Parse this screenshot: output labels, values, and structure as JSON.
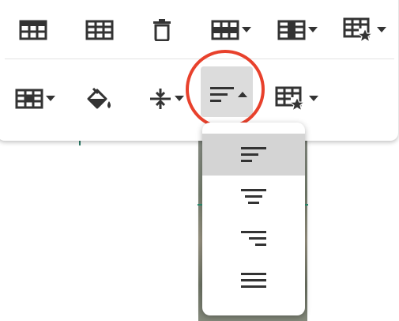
{
  "toolbar": {
    "row1": [
      {
        "icon": "table-icon"
      },
      {
        "icon": "table-grid-icon"
      },
      {
        "icon": "trash-icon"
      },
      {
        "icon": "table-row-icon",
        "dropdown": true
      },
      {
        "icon": "table-column-icon",
        "dropdown": true
      },
      {
        "icon": "table-star-icon",
        "dropdown": true
      }
    ],
    "row2": [
      {
        "icon": "table-cell-icon",
        "dropdown": true
      },
      {
        "icon": "fill-color-icon"
      },
      {
        "icon": "vertical-align-icon",
        "dropdown": true
      },
      {
        "icon": "text-align-left-icon",
        "dropdown": true,
        "active": true
      },
      {
        "icon": "table-star-icon",
        "dropdown": true
      }
    ]
  },
  "align_menu": {
    "options": [
      {
        "icon": "align-left-icon",
        "selected": true
      },
      {
        "icon": "align-center-icon",
        "selected": false
      },
      {
        "icon": "align-right-icon",
        "selected": false
      },
      {
        "icon": "align-justify-icon",
        "selected": false
      }
    ]
  },
  "colors": {
    "icon": "#333333",
    "highlight_ring": "#e8412c",
    "active_bg": "#dcdcdc",
    "selected_item": "#d4d4d4"
  }
}
